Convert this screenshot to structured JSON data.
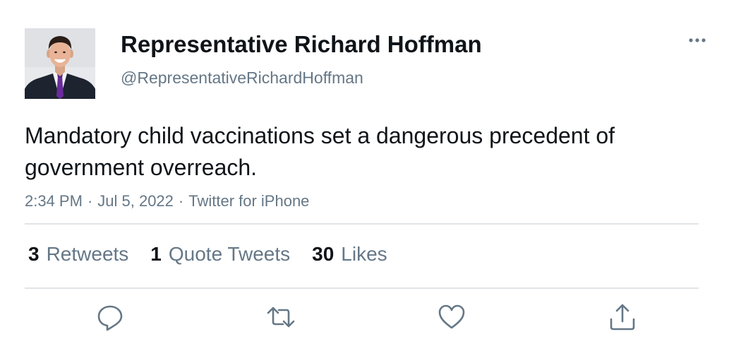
{
  "author": {
    "display_name": "Representative Richard Hoffman",
    "handle": "@RepresentativeRichardHoffman",
    "avatar_icon": "profile-photo-man-in-suit"
  },
  "tweet": {
    "text": "Mandatory child vaccinations set a dangerous precedent of government overreach.",
    "time": "2:34 PM",
    "date": "Jul 5, 2022",
    "source": "Twitter for iPhone",
    "separator": "·"
  },
  "stats": {
    "retweets": {
      "count": "3",
      "label": "Retweets"
    },
    "quote_tweets": {
      "count": "1",
      "label": "Quote Tweets"
    },
    "likes": {
      "count": "30",
      "label": "Likes"
    }
  },
  "icons": {
    "more": "more-horizontal-icon",
    "reply": "reply-icon",
    "retweet": "retweet-icon",
    "like": "like-icon",
    "share": "share-icon"
  },
  "colors": {
    "text_primary": "#0f1419",
    "text_secondary": "#657786",
    "divider": "#e1e5e8"
  }
}
